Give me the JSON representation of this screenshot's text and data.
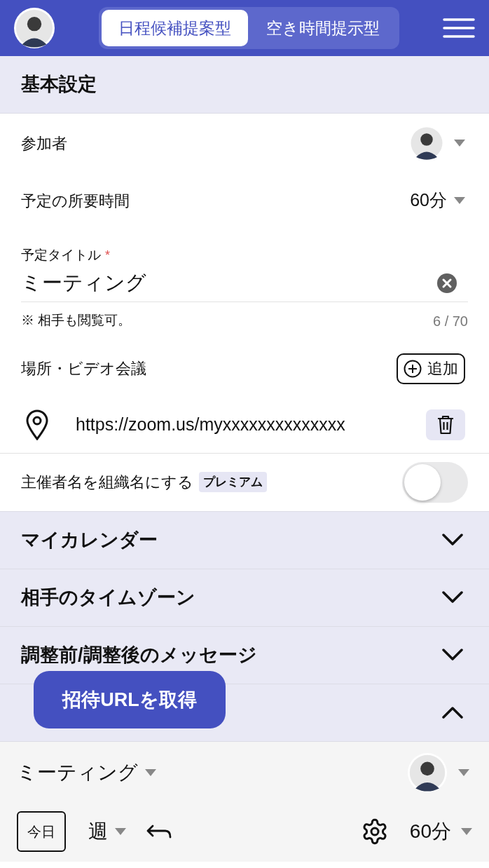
{
  "header": {
    "tabs": [
      {
        "label": "日程候補提案型",
        "selected": true
      },
      {
        "label": "空き時間提示型",
        "selected": false
      }
    ]
  },
  "basic_settings": {
    "title": "基本設定",
    "participants_label": "参加者",
    "duration": {
      "label": "予定の所要時間",
      "value": "60分"
    },
    "event_title": {
      "label": "予定タイトル",
      "required_mark": "*",
      "value": "ミーティング",
      "note": "※ 相手も閲覧可。",
      "counter": "6 / 70"
    },
    "location": {
      "label": "場所・ビデオ会議",
      "add_button": "追加",
      "url": "https://zoom.us/myxxxxxxxxxxxxxx"
    },
    "organizer_toggle": {
      "label": "主催者名を組織名にする",
      "badge": "プレミアム",
      "on": false
    }
  },
  "sections": [
    {
      "title": "マイカレンダー",
      "expanded": false
    },
    {
      "title": "相手のタイムゾーン",
      "expanded": false
    },
    {
      "title": "調整前/調整後のメッセージ",
      "expanded": false
    },
    {
      "expanded": true
    }
  ],
  "floating_button": "招待URLを取得",
  "toolbar": {
    "event_select": "ミーティング",
    "today_button": "今日",
    "view_select": "週",
    "duration_select": "60分"
  }
}
